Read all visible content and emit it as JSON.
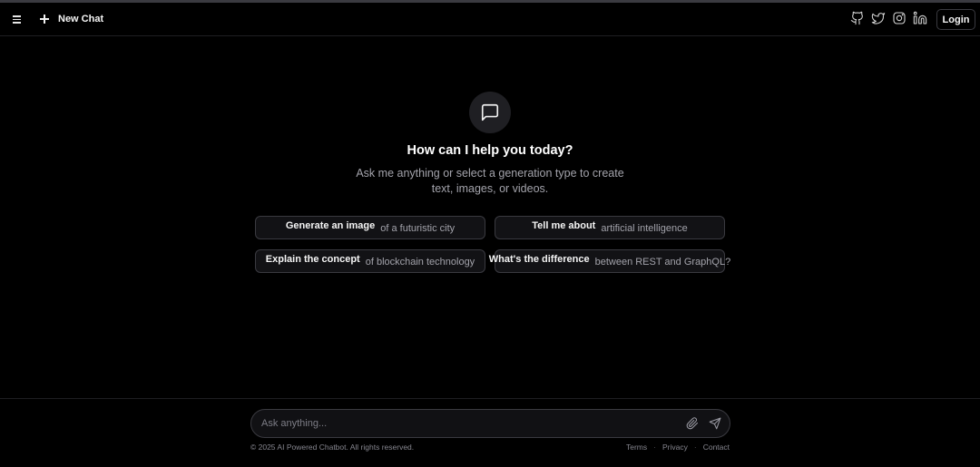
{
  "header": {
    "new_chat_label": "New Chat",
    "login_label": "Login",
    "socials": [
      "github-icon",
      "twitter-icon",
      "instagram-icon",
      "linkedin-icon"
    ]
  },
  "hero": {
    "icon": "chat-bubble-icon",
    "title": "How can I help you today?",
    "subtitle": "Ask me anything or select a generation type to create text, images, or videos."
  },
  "suggestions": [
    {
      "lead": "Generate an image",
      "rest": "of a futuristic city"
    },
    {
      "lead": "Tell me about",
      "rest": "artificial intelligence"
    },
    {
      "lead": "Explain the concept",
      "rest": "of blockchain technology"
    },
    {
      "lead": "What's the difference",
      "rest": "between REST and GraphQL?"
    }
  ],
  "composer": {
    "placeholder": "Ask anything...",
    "attach_icon": "paperclip-icon",
    "send_icon": "send-icon"
  },
  "footer": {
    "copyright": "© 2025 AI Powered Chatbot. All rights reserved.",
    "links": [
      "Terms",
      "Privacy",
      "Contact"
    ],
    "separator": "·"
  },
  "colors": {
    "background": "#000000",
    "card": "#121215",
    "border": "#3a3a40",
    "muted_text": "#a3a3ab"
  }
}
